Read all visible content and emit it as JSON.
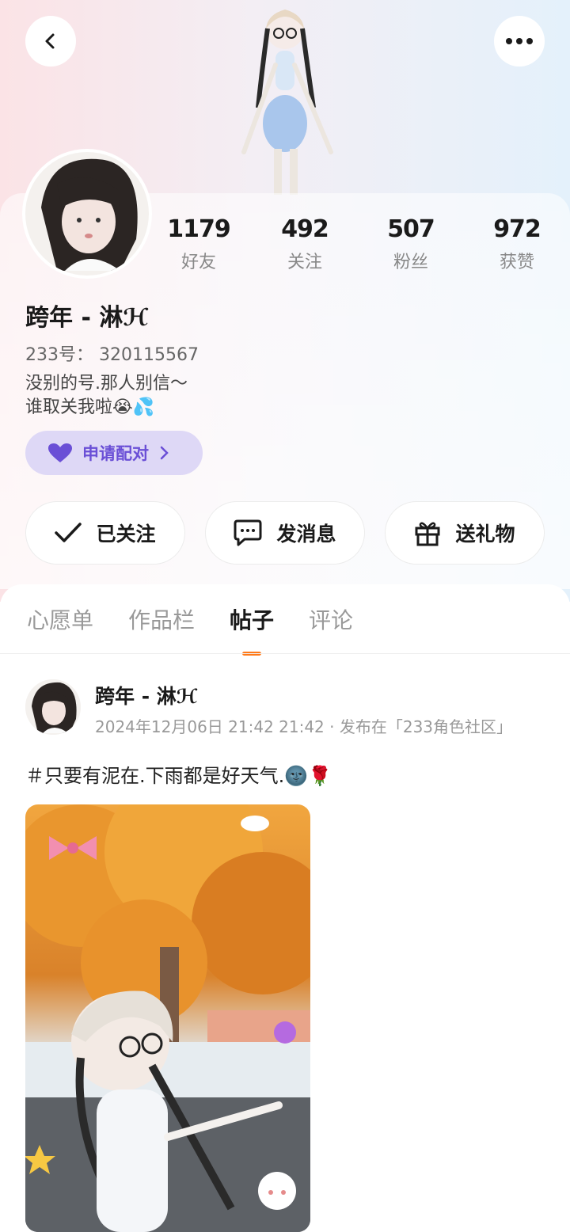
{
  "header": {
    "back_icon": "chevron-left-icon",
    "more_icon": "more-dots-icon"
  },
  "profile": {
    "name": "跨年 - 淋ℋ",
    "uid": "233号：  320115567",
    "bio_line1": "没别的号.那人别信～",
    "bio_line2": "谁取关我啦😭💦",
    "pair_button": "申请配对",
    "stats": [
      {
        "value": "1179",
        "label": "好友"
      },
      {
        "value": "492",
        "label": "关注"
      },
      {
        "value": "507",
        "label": "粉丝"
      },
      {
        "value": "972",
        "label": "获赞"
      }
    ]
  },
  "actions": {
    "follow": "已关注",
    "message": "发消息",
    "gift": "送礼物"
  },
  "tabs": [
    "心愿单",
    "作品栏",
    "帖子",
    "评论"
  ],
  "active_tab": "帖子",
  "post": {
    "author": "跨年 - 淋ℋ",
    "meta": "2024年12月06日 21:42 21:42 · 发布在「233角色社区」",
    "text": "＃只要有泥在.下雨都是好天气.🌚🌹"
  },
  "colors": {
    "accent_orange": "#ff7a1a",
    "pair_purple": "#6a4fd6",
    "pair_bg": "#ded8f6"
  }
}
